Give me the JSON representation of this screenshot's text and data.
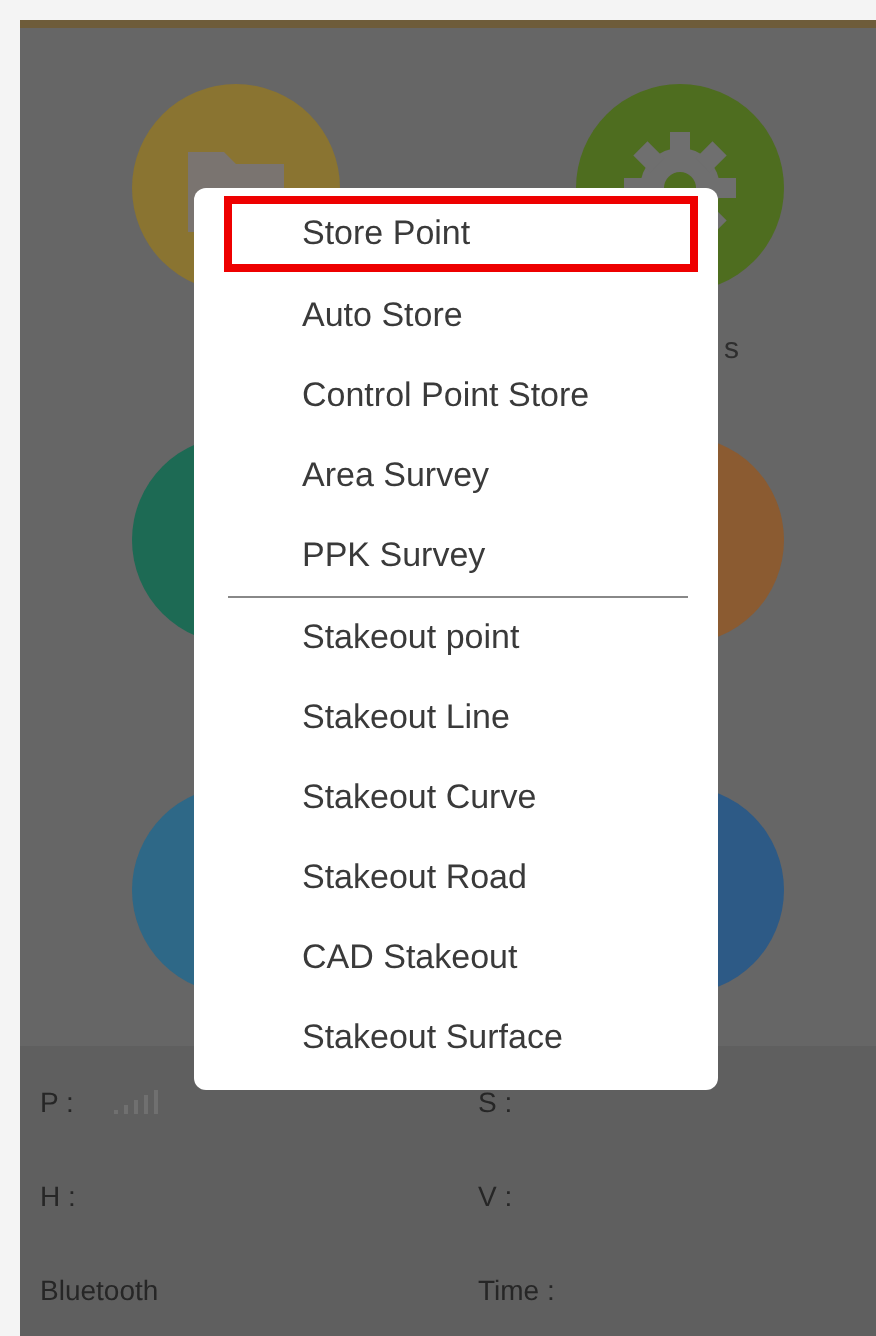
{
  "tiles": [
    {
      "color": "#8a7431"
    },
    {
      "color": "#4e6d1f"
    },
    {
      "color": "#1d6a54"
    },
    {
      "color": "#8b5b31"
    },
    {
      "color": "#2e6887"
    },
    {
      "color": "#2d5a86"
    }
  ],
  "tile_label_fragment": "s",
  "menu": [
    {
      "label": "Store Point",
      "selected": true
    },
    {
      "label": "Auto Store",
      "selected": false
    },
    {
      "label": "Control Point Store",
      "selected": false
    },
    {
      "label": "Area Survey",
      "selected": false
    },
    {
      "label": "PPK Survey",
      "selected": false,
      "divider_after": true
    },
    {
      "label": "Stakeout point",
      "selected": false
    },
    {
      "label": "Stakeout Line",
      "selected": false
    },
    {
      "label": "Stakeout Curve",
      "selected": false
    },
    {
      "label": "Stakeout Road",
      "selected": false
    },
    {
      "label": "CAD Stakeout",
      "selected": false
    },
    {
      "label": "Stakeout Surface",
      "selected": false
    }
  ],
  "status": [
    {
      "label": "P :",
      "kind": "signal"
    },
    {
      "label": "S :",
      "kind": "text"
    },
    {
      "label": "H :",
      "kind": "text"
    },
    {
      "label": "V :",
      "kind": "text"
    },
    {
      "label": "Bluetooth",
      "kind": "text"
    },
    {
      "label": "Time :",
      "kind": "text"
    }
  ]
}
